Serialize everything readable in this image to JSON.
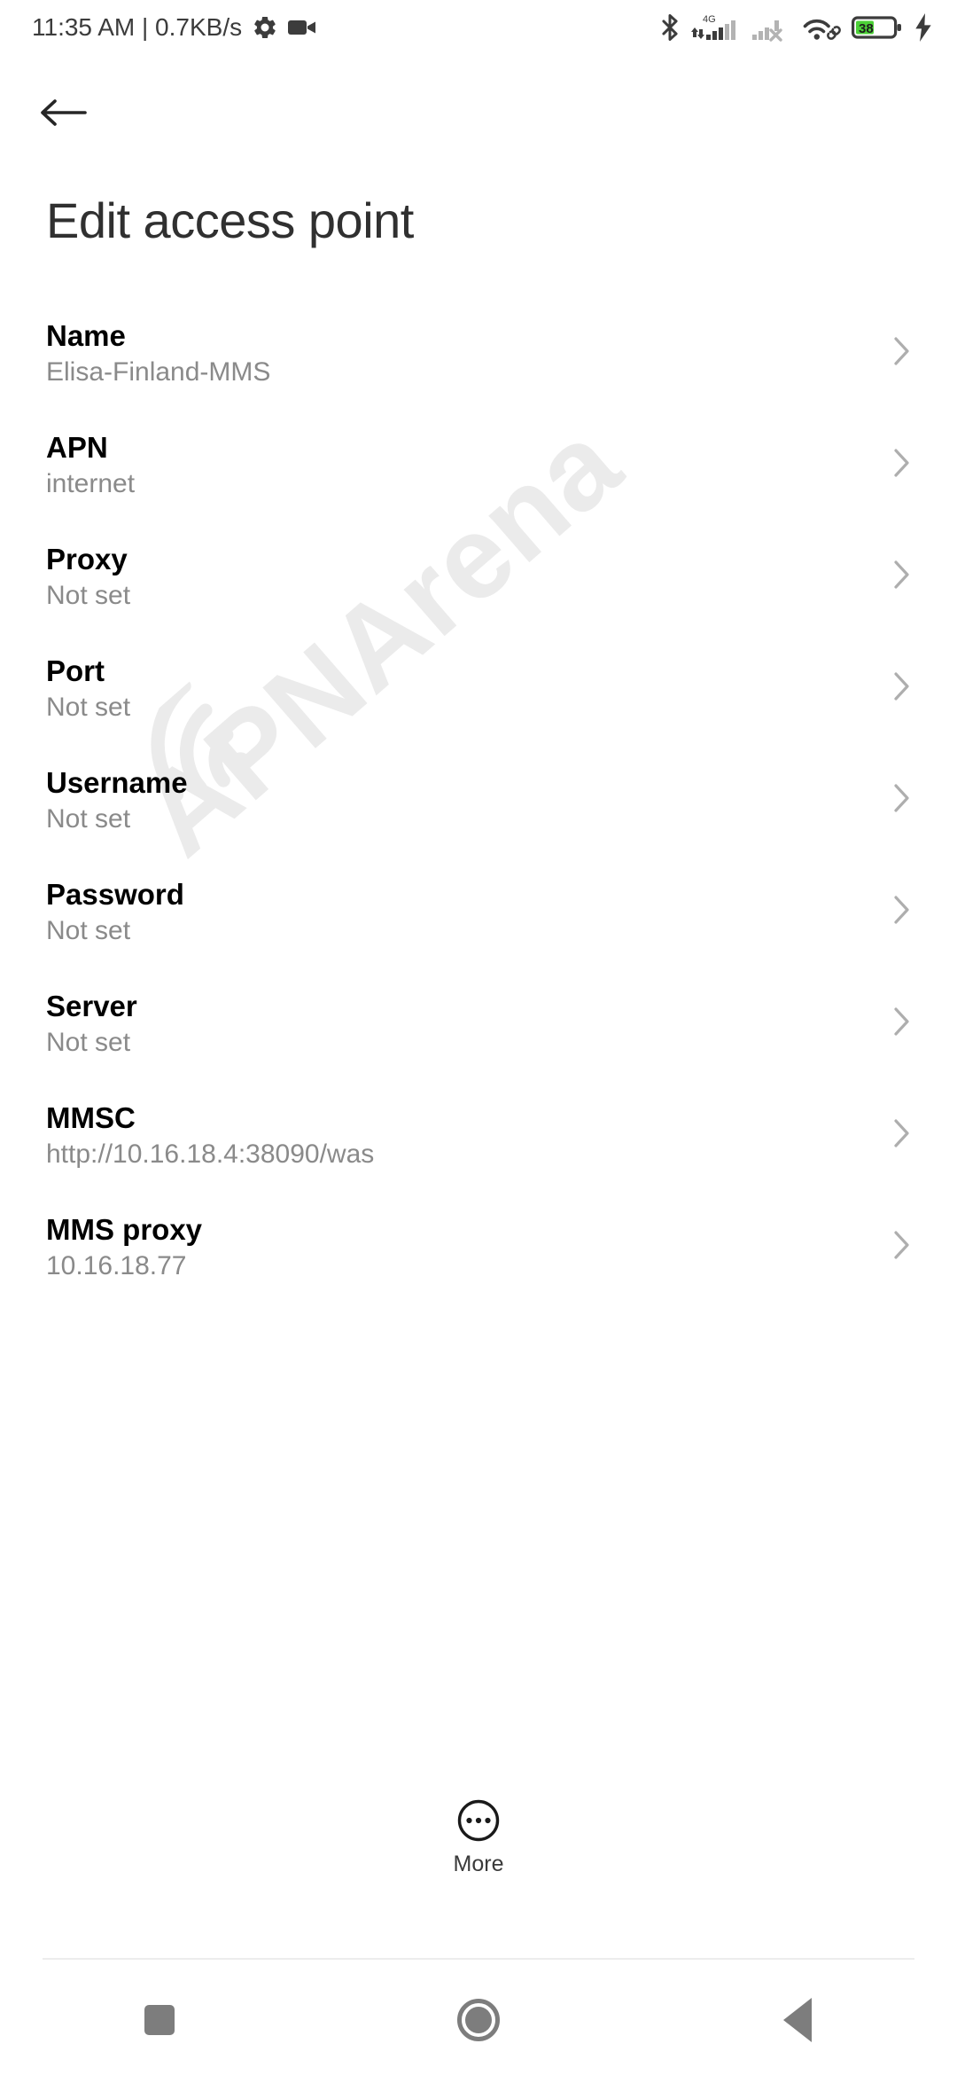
{
  "status_bar": {
    "clock": "11:35 AM | 0.7KB/s",
    "icons_left": [
      "gear-icon",
      "video-camera-icon"
    ],
    "icons_right": [
      "bluetooth-icon",
      "mobile-signal-4g-icon",
      "mobile-signal-no-service-icon",
      "wifi-icon",
      "battery-icon",
      "charging-bolt-icon"
    ],
    "network_type": "4G",
    "battery_level": "38",
    "battery_color": "#4cd137",
    "icon_color": "#3c3c3c"
  },
  "app_bar": {
    "back_icon": "arrow-left-icon",
    "title": "Edit access point"
  },
  "settings": {
    "rows": [
      {
        "label": "Name",
        "value": "Elisa-Finland-MMS"
      },
      {
        "label": "APN",
        "value": "internet"
      },
      {
        "label": "Proxy",
        "value": "Not set"
      },
      {
        "label": "Port",
        "value": "Not set"
      },
      {
        "label": "Username",
        "value": "Not set"
      },
      {
        "label": "Password",
        "value": "Not set"
      },
      {
        "label": "Server",
        "value": "Not set"
      },
      {
        "label": "MMSC",
        "value": "http://10.16.18.4:38090/was"
      },
      {
        "label": "MMS proxy",
        "value": "10.16.18.77"
      }
    ],
    "chevron_icon": "chevron-right-icon",
    "label_color": "#000000",
    "value_color": "#8a8a8a"
  },
  "more_button": {
    "label": "More",
    "icon": "more-circle-icon"
  },
  "nav_bar": {
    "recents_icon": "square-recents-icon",
    "home_icon": "circle-home-icon",
    "back_icon": "triangle-back-icon",
    "color": "#7d7d7d"
  },
  "watermark": {
    "text": "APNArena",
    "logo_icon": "wifi-arc-logo-icon",
    "color": "#ebebeb"
  }
}
